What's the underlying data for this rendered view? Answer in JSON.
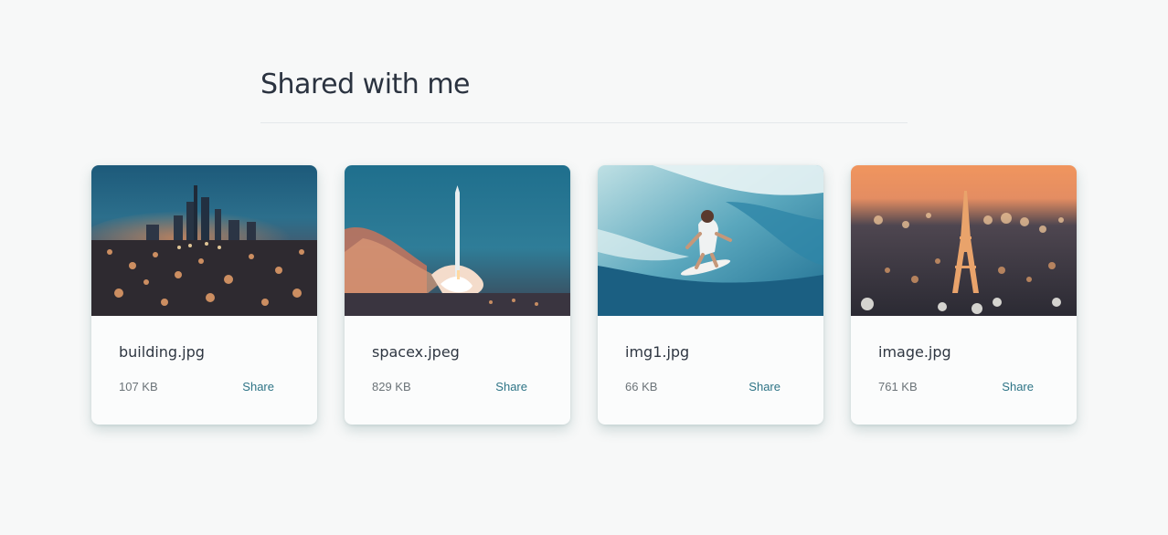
{
  "page": {
    "title": "Shared with me"
  },
  "files": [
    {
      "name": "building.jpg",
      "size": "107 KB",
      "share_label": "Share",
      "thumbnail": "city-skyline-night-image"
    },
    {
      "name": "spacex.jpeg",
      "size": "829 KB",
      "share_label": "Share",
      "thumbnail": "rocket-launch-image"
    },
    {
      "name": "img1.jpg",
      "size": "66 KB",
      "share_label": "Share",
      "thumbnail": "surfer-wave-image"
    },
    {
      "name": "image.jpg",
      "size": "761 KB",
      "share_label": "Share",
      "thumbnail": "eiffel-tower-night-image"
    }
  ],
  "colors": {
    "background": "#f7f8f8",
    "accent": "#2e7486",
    "title": "#2b3340"
  }
}
